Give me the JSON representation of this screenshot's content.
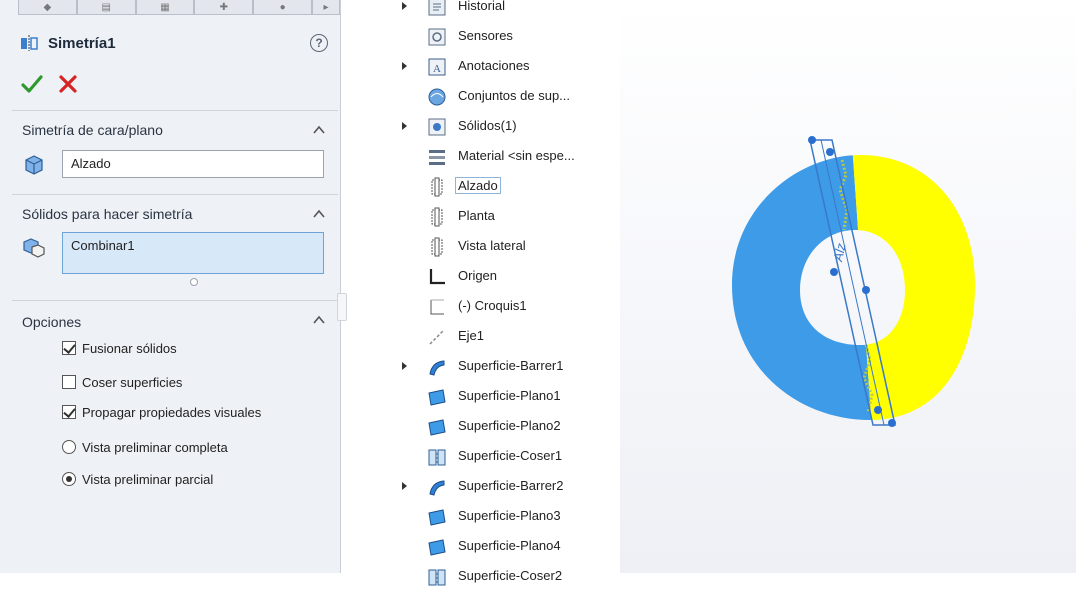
{
  "property_manager": {
    "title": "Simetría1",
    "tabs": [
      "",
      "",
      "",
      "",
      "",
      ""
    ],
    "help_icon": "?",
    "ok_icon": "check-icon",
    "cancel_icon": "close-icon",
    "mirror_face": {
      "title": "Simetría de cara/plano",
      "value": "Alzado"
    },
    "bodies": {
      "title": "Sólidos para hacer simetría",
      "value": "Combinar1"
    },
    "options": {
      "title": "Opciones",
      "merge": {
        "label": "Fusionar sólidos",
        "checked": true
      },
      "knit": {
        "label": "Coser superficies",
        "checked": false
      },
      "propagate": {
        "label": "Propagar propiedades visuales",
        "checked": true
      },
      "full_preview": {
        "label": "Vista preliminar completa",
        "selected": false
      },
      "partial_preview": {
        "label": "Vista preliminar parcial",
        "selected": true
      }
    }
  },
  "tree": [
    {
      "label": "Historial",
      "icon": "history-icon",
      "expandable": true
    },
    {
      "label": "Sensores",
      "icon": "sensor-icon",
      "expandable": false
    },
    {
      "label": "Anotaciones",
      "icon": "annotation-icon",
      "expandable": true
    },
    {
      "label": "Conjuntos de sup...",
      "icon": "surface-set-icon",
      "expandable": false
    },
    {
      "label": "Sólidos(1)",
      "icon": "solid-bodies-icon",
      "expandable": true
    },
    {
      "label": "Material <sin espe...",
      "icon": "material-icon",
      "expandable": false
    },
    {
      "label": "Alzado",
      "icon": "plane-icon",
      "expandable": false,
      "selected": true
    },
    {
      "label": "Planta",
      "icon": "plane-icon",
      "expandable": false
    },
    {
      "label": "Vista lateral",
      "icon": "plane-icon",
      "expandable": false
    },
    {
      "label": "Origen",
      "icon": "origin-icon",
      "expandable": false
    },
    {
      "label": "(-) Croquis1",
      "icon": "sketch-icon",
      "expandable": false
    },
    {
      "label": "Eje1",
      "icon": "axis-icon",
      "expandable": false
    },
    {
      "label": "Superficie-Barrer1",
      "icon": "sweep-surface-icon",
      "expandable": true
    },
    {
      "label": "Superficie-Plano1",
      "icon": "planar-surface-icon",
      "expandable": false
    },
    {
      "label": "Superficie-Plano2",
      "icon": "planar-surface-icon",
      "expandable": false
    },
    {
      "label": "Superficie-Coser1",
      "icon": "knit-surface-icon",
      "expandable": false
    },
    {
      "label": "Superficie-Barrer2",
      "icon": "sweep-surface-icon",
      "expandable": true
    },
    {
      "label": "Superficie-Plano3",
      "icon": "planar-surface-icon",
      "expandable": false
    },
    {
      "label": "Superficie-Plano4",
      "icon": "planar-surface-icon",
      "expandable": false
    },
    {
      "label": "Superficie-Coser2",
      "icon": "knit-surface-icon",
      "expandable": false
    }
  ],
  "viewport": {
    "plane_label": "Alz",
    "colors": {
      "body": "#3d9be8",
      "mirror_preview": "#ffff00",
      "plane": "#3a78c8",
      "handle": "#2a6fcf"
    }
  }
}
